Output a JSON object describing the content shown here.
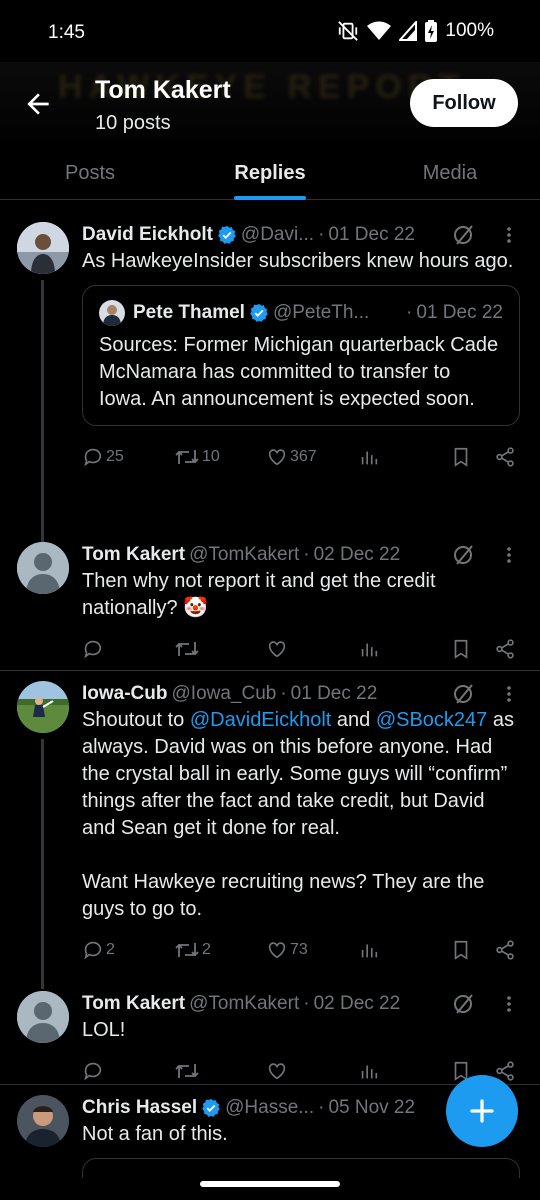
{
  "status_bar": {
    "time": "1:45",
    "battery": "100%"
  },
  "header": {
    "name": "Tom Kakert",
    "posts": "10 posts",
    "follow_label": "Follow",
    "banner_text": "HAWKEYE REPORT"
  },
  "tabs": [
    {
      "label": "Posts",
      "active": false
    },
    {
      "label": "Replies",
      "active": true
    },
    {
      "label": "Media",
      "active": false
    }
  ],
  "tweets": [
    {
      "name": "David Eickholt",
      "verified": true,
      "handle": "@Davi...",
      "date": "01 Dec 22",
      "text": "As HawkeyeInsider subscribers knew hours ago.",
      "quote": {
        "name": "Pete Thamel",
        "verified": true,
        "handle": "@PeteTh...",
        "date": "01 Dec 22",
        "text": "Sources: Former Michigan quarterback Cade McNamara has committed to transfer to Iowa. An announcement is expected soon."
      },
      "stats": {
        "replies": "25",
        "retweets": "10",
        "likes": "367"
      }
    },
    {
      "name": "Tom Kakert",
      "verified": false,
      "handle": "@TomKakert",
      "date": "02 Dec 22",
      "text": "Then why not report it and get the credit nationally? 🤡",
      "stats": {
        "replies": "",
        "retweets": "",
        "likes": ""
      }
    },
    {
      "name": "Iowa-Cub",
      "verified": false,
      "handle": "@Iowa_Cub",
      "date": "01 Dec 22",
      "text_before": "Shoutout to ",
      "mention1": "@DavidEickholt",
      "text_mid": " and ",
      "mention2": "@SBock247",
      "text_after": " as always. David was on this before anyone. Had the crystal ball in early. Some guys will “confirm” things after the fact and take credit, but David and Sean get it done for real.\n\nWant Hawkeye recruiting news? They are the guys to go to.",
      "stats": {
        "replies": "2",
        "retweets": "2",
        "likes": "73"
      }
    },
    {
      "name": "Tom Kakert",
      "verified": false,
      "handle": "@TomKakert",
      "date": "02 Dec 22",
      "text": "LOL!",
      "stats": {
        "replies": "",
        "retweets": "",
        "likes": ""
      }
    },
    {
      "name": "Chris Hassel",
      "verified": true,
      "handle": "@Hasse...",
      "date": "05 Nov 22",
      "text": "Not a fan of this."
    }
  ],
  "colors": {
    "accent": "#1d9bf0",
    "muted": "#71767b",
    "text": "#e7e9ea",
    "divider": "#2f3336"
  }
}
